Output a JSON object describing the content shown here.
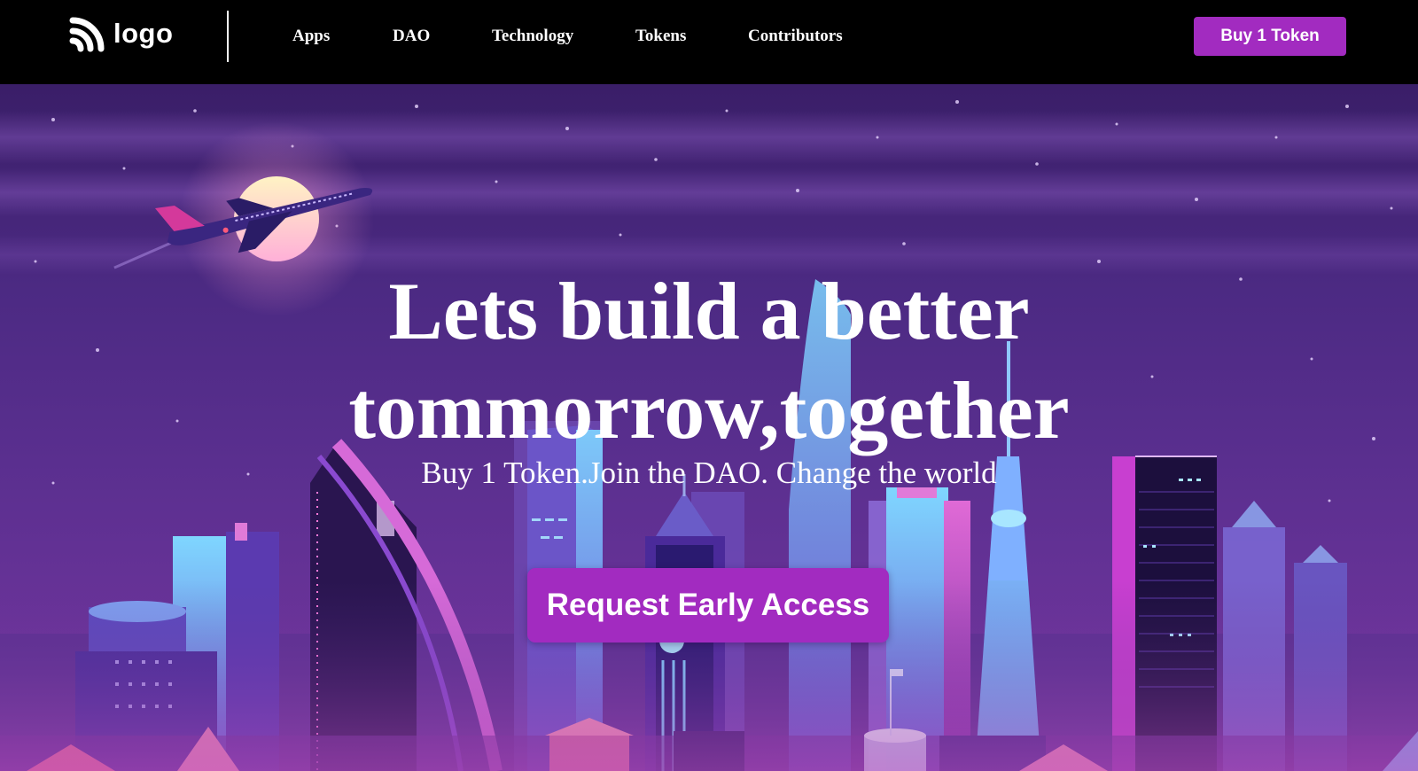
{
  "nav": {
    "logo_text": "logo",
    "logo_icon": "rss-feed-icon",
    "links": [
      "Apps",
      "DAO",
      "Technology",
      "Tokens",
      "Contributors"
    ],
    "buy_button": "Buy 1 Token"
  },
  "hero": {
    "headline_line1": "Lets build a better",
    "headline_line2": "tommorrow,together",
    "subheadline": "Buy 1 Token.Join the DAO. Change the world",
    "cta_button": "Request Early Access",
    "illustration": "night-city-skyline-illustration"
  },
  "colors": {
    "accent": "#a22bc0",
    "navbar_bg": "#000000",
    "sky_top": "#3a1e68",
    "sky_bottom": "#7a37a0"
  }
}
